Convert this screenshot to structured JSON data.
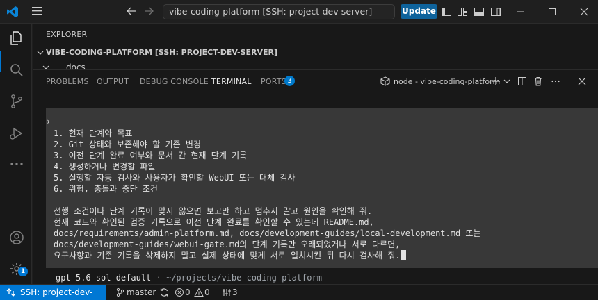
{
  "titlebar": {
    "search_text": "vibe-coding-platform [SSH: project-dev-server]",
    "update_label": "Update"
  },
  "explorer": {
    "title": "EXPLORER",
    "root": "VIBE-CODING-PLATFORM [SSH: PROJECT-DEV-SERVER]",
    "folder": "docs"
  },
  "panel": {
    "tabs": [
      "PROBLEMS",
      "OUTPUT",
      "DEBUG CONSOLE",
      "TERMINAL",
      "PORTS"
    ],
    "active_tab": "TERMINAL",
    "ports_count": "3",
    "terminal_name": "node - vibe-coding-platform"
  },
  "terminal": {
    "prompt": "›",
    "lines": [
      "1. 현재 단계와 목표",
      "2. Git 상태와 보존해야 할 기존 변경",
      "3. 이전 단계 완료 여부와 문서 간 현재 단계 기록",
      "4. 생성하거나 변경할 파일",
      "5. 실행할 자동 검사와 사용자가 확인할 WebUI 또는 대체 검사",
      "6. 위험, 충돌과 중단 조건",
      "",
      "선행 조건이나 단계 기록이 맞지 않으면 보고만 하고 멈추지 말고 원인을 확인해 줘.",
      "현재 코드와 확인된 검증 기록으로 이전 단계 완료를 확인할 수 있는데 README.md,",
      "docs/requirements/admin-platform.md, docs/development-guides/local-development.md 또는",
      "docs/development-guides/webui-gate.md의 단계 기록만 오래되었거나 서로 다르면,",
      "요구사항과 기존 기록을 삭제하지 말고 실제 상태에 맞게 서로 일치시킨 뒤 다시 검사해 줘."
    ],
    "footer_model": "gpt-5.6-sol default",
    "footer_sep": " · ",
    "footer_path": "~/projects/vibe-coding-platform"
  },
  "statusbar": {
    "remote": "SSH: project-dev-server",
    "branch": "master",
    "errors": "0",
    "warnings": "0",
    "ports": "3"
  },
  "activity": {
    "accounts_badge": "1"
  },
  "colors": {
    "accent": "#0078d4",
    "update_button": "#0e639c",
    "terminal_block": "#383838"
  }
}
